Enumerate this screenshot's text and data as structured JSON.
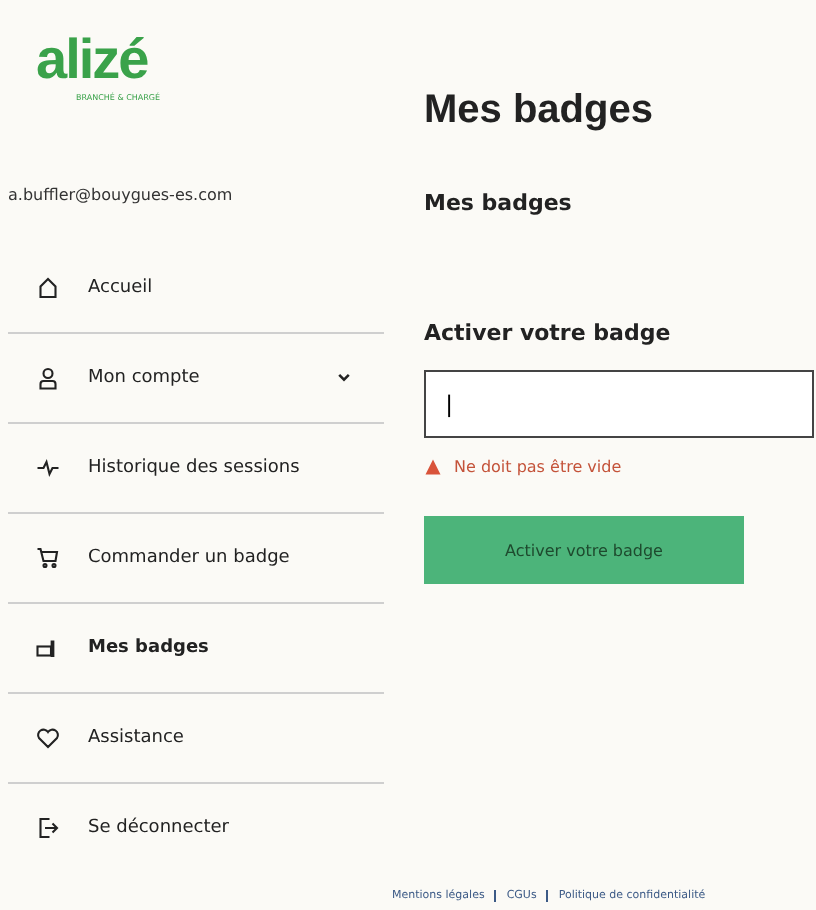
{
  "brand": {
    "logo": "alizé",
    "tagline": "BRANCHÉ & CHARGÉ"
  },
  "user": {
    "email": "a.buffler@bouygues-es.com"
  },
  "menu": [
    {
      "label": "Accueil",
      "kind": "home",
      "selected": false
    },
    {
      "label": "Mon compte",
      "kind": "user",
      "selected": false,
      "expanded": false
    },
    {
      "label": "Historique des sessions",
      "kind": "pulse",
      "selected": false
    },
    {
      "label": "Commander un badge",
      "kind": "cart",
      "selected": false
    },
    {
      "label": "Mes badges",
      "kind": "badge",
      "selected": true
    },
    {
      "label": "Assistance",
      "kind": "heart",
      "selected": false
    },
    {
      "label": "Se déconnecter",
      "kind": "logout",
      "selected": false
    }
  ],
  "page": {
    "title": "Mes badges",
    "subtitle": "Mes badges",
    "form_title": "Activer votre badge",
    "input": {
      "value": "|"
    },
    "error": "Ne doit pas être vide",
    "button": "Activer votre badge"
  },
  "footer": [
    "Mentions légales",
    "CGUs",
    "Politique de confidentialité"
  ]
}
